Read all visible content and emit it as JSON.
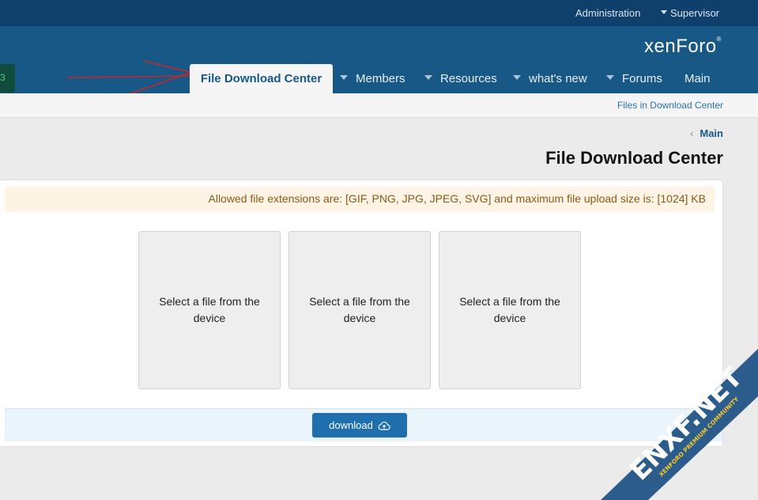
{
  "topbar": {
    "administration": "Administration",
    "supervisor": "Supervisor"
  },
  "header": {
    "logo": "xenForo",
    "logo_mark": "®",
    "left_badge": "3"
  },
  "nav": {
    "tabs": [
      {
        "label": "File Download Center",
        "active": true
      },
      {
        "label": "Members",
        "active": false
      },
      {
        "label": "Resources",
        "active": false
      },
      {
        "label": "what's new",
        "active": false
      },
      {
        "label": "Forums",
        "active": false
      },
      {
        "label": "Main",
        "active": false
      }
    ]
  },
  "subnav": {
    "link": "Files in Download Center"
  },
  "breadcrumb": {
    "label": "Main"
  },
  "page": {
    "title": "File Download Center"
  },
  "notice": {
    "text": "Allowed file extensions are: [GIF, PNG, JPG, JPEG, SVG] and maximum file upload size is: [1024] KB"
  },
  "slots": [
    {
      "label": "Select a file from the device"
    },
    {
      "label": "Select a file from the device"
    },
    {
      "label": "Select a file from the device"
    }
  ],
  "footer": {
    "download_label": "download"
  },
  "watermark": {
    "brand": "ENXF.NET",
    "tagline": "XENFORO PREMIUM COMMUNITY"
  },
  "colors": {
    "topbar": "#0f3f6b",
    "header": "#185886",
    "accent": "#1f6fae",
    "notice_bg": "#fef4e6",
    "arrow": "#c8262d"
  }
}
